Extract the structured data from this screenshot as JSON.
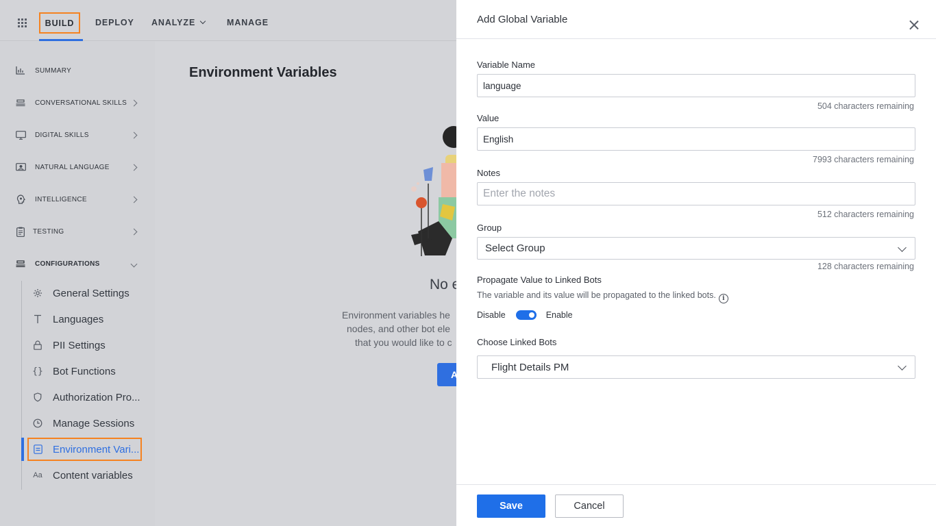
{
  "topnav": {
    "items": [
      "BUILD",
      "DEPLOY",
      "ANALYZE",
      "MANAGE"
    ]
  },
  "sidebar": {
    "items": [
      {
        "label": "SUMMARY",
        "icon": "bar-chart-icon"
      },
      {
        "label": "CONVERSATIONAL SKILLS",
        "icon": "layers-icon"
      },
      {
        "label": "DIGITAL SKILLS",
        "icon": "monitor-icon"
      },
      {
        "label": "NATURAL LANGUAGE",
        "icon": "nlp-icon"
      },
      {
        "label": "INTELLIGENCE",
        "icon": "brain-icon"
      },
      {
        "label": "TESTING",
        "icon": "clipboard-icon"
      },
      {
        "label": "CONFIGURATIONS",
        "icon": "layers-icon"
      }
    ],
    "config_sub": [
      {
        "label": "General Settings",
        "icon": "gear-icon"
      },
      {
        "label": "Languages",
        "icon": "text-icon"
      },
      {
        "label": "PII Settings",
        "icon": "lock-icon"
      },
      {
        "label": "Bot Functions",
        "icon": "braces-icon"
      },
      {
        "label": "Authorization Pro...",
        "icon": "shield-icon"
      },
      {
        "label": "Manage Sessions",
        "icon": "clock-icon"
      },
      {
        "label": "Environment Vari...",
        "icon": "document-icon"
      },
      {
        "label": "Content variables",
        "icon": "font-size-icon"
      }
    ]
  },
  "main": {
    "title": "Environment Variables",
    "empty_title": "No e",
    "desc_lines": [
      "Environment variables he",
      "nodes, and other bot ele",
      "that you would like to c"
    ],
    "add_button_peek": "A"
  },
  "panel": {
    "title": "Add Global Variable",
    "variable_name": {
      "label": "Variable Name",
      "value": "language",
      "counter": "504 characters remaining"
    },
    "value": {
      "label": "Value",
      "value": "English",
      "counter": "7993 characters remaining"
    },
    "notes": {
      "label": "Notes",
      "placeholder": "Enter the notes",
      "counter": "512 characters remaining"
    },
    "group": {
      "label": "Group",
      "selected": "Select Group",
      "counter": "128 characters remaining"
    },
    "propagate": {
      "label": "Propagate Value to Linked Bots",
      "description": "The variable and its value will be propagated to the linked bots.",
      "disable_label": "Disable",
      "enable_label": "Enable",
      "enabled": true
    },
    "linked_bots": {
      "label": "Choose Linked Bots",
      "selected": "Flight Details PM"
    },
    "save_label": "Save",
    "cancel_label": "Cancel"
  },
  "colors": {
    "accent": "#1f6fe8",
    "highlight_box": "#f58220",
    "overlay_bg": "#d4d5d9"
  }
}
